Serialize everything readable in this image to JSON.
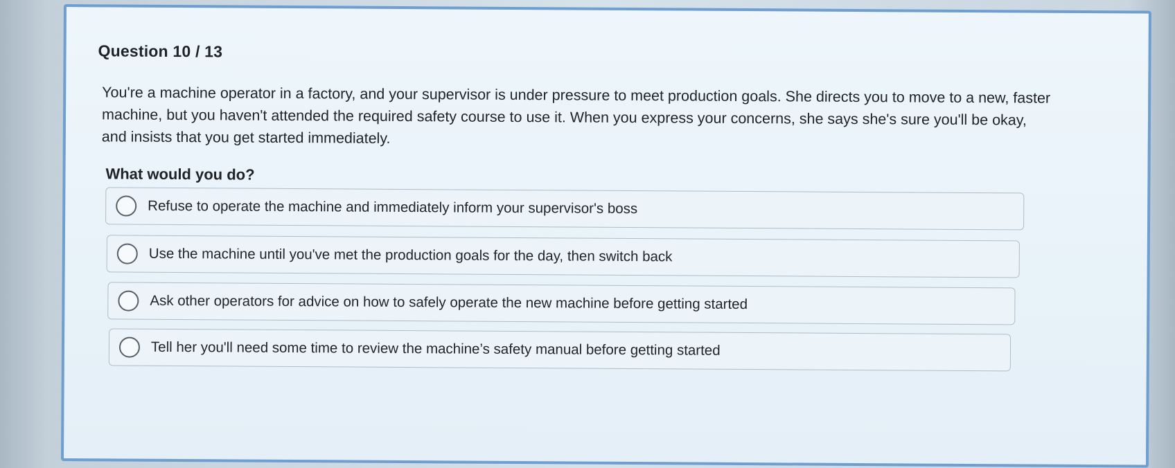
{
  "question": {
    "header": "Question 10 / 13",
    "text": "You're a machine operator in a factory, and your supervisor is under pressure to meet production goals. She directs you to move to a new, faster machine, but you haven't attended the required safety course to use it. When you express your concerns, she says she's sure you'll be okay, and insists that you get started immediately.",
    "prompt": "What would you do?"
  },
  "options": [
    {
      "label": "Refuse to operate the machine and immediately inform your supervisor's boss"
    },
    {
      "label": "Use the machine until you've met the production goals for the day, then switch back"
    },
    {
      "label": "Ask other operators for advice on how to safely operate the new machine before getting started"
    },
    {
      "label": "Tell her you'll need some time to review the machine’s safety manual before getting started"
    }
  ],
  "colors": {
    "card_border": "#6f9fd1",
    "card_background": "#eef6fb",
    "text": "#1f2328",
    "option_border": "#aebdc9"
  }
}
